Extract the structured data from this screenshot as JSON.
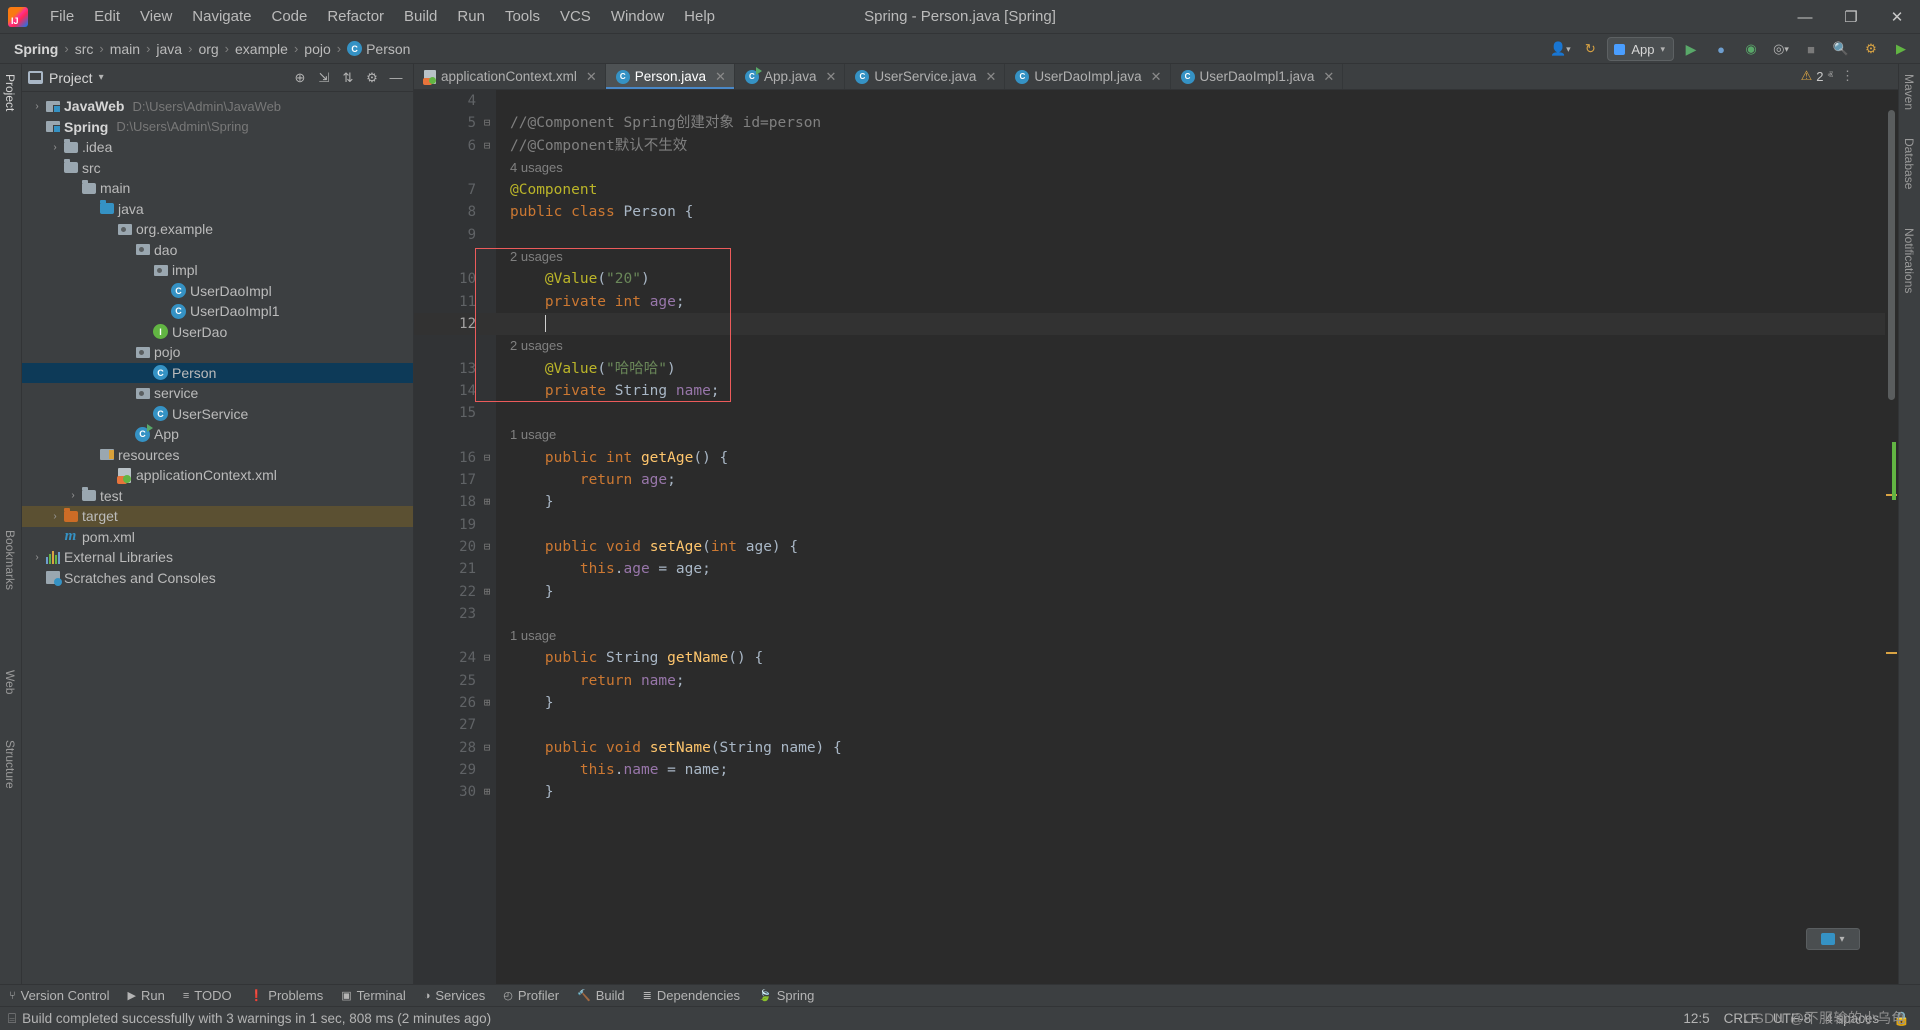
{
  "window": {
    "title": "Spring - Person.java [Spring]",
    "minimize_label": "—",
    "maximize_label": "❐",
    "close_label": "✕"
  },
  "menu": {
    "items": [
      "File",
      "Edit",
      "View",
      "Navigate",
      "Code",
      "Refactor",
      "Build",
      "Run",
      "Tools",
      "VCS",
      "Window",
      "Help"
    ]
  },
  "breadcrumb": {
    "items": [
      "Spring",
      "src",
      "main",
      "java",
      "org",
      "example",
      "pojo",
      "Person"
    ],
    "separator": "›"
  },
  "toolbar": {
    "run_config_label": "App",
    "run_label": "▶",
    "debug_label": "🐞",
    "profile_label": "◉",
    "stop_label": "■",
    "search_label": "🔍",
    "account_label": "👤",
    "update_label": "↻",
    "settings_label": "⚙"
  },
  "left_strip": {
    "items": [
      "Project",
      "Bookmarks",
      "Web",
      "Structure"
    ]
  },
  "right_strip": {
    "items": [
      "Maven",
      "Database",
      "Notifications"
    ]
  },
  "project_panel": {
    "title": "Project",
    "dropdown": "▾",
    "tools": [
      "⊕",
      "⇲",
      "⇅",
      "⚙",
      "—"
    ],
    "tree": [
      {
        "depth": 0,
        "arrow": "›",
        "icon": "module",
        "label": "JavaWeb",
        "bold": true,
        "hint": "D:\\Users\\Admin\\JavaWeb",
        "state": "normal"
      },
      {
        "depth": 0,
        "arrow": "ⱟ",
        "icon": "module",
        "label": "Spring",
        "bold": true,
        "hint": "D:\\Users\\Admin\\Spring",
        "state": "normal"
      },
      {
        "depth": 1,
        "arrow": "›",
        "icon": "folder",
        "label": ".idea",
        "bold": false,
        "hint": "",
        "state": "normal"
      },
      {
        "depth": 1,
        "arrow": "ⱟ",
        "icon": "folder",
        "label": "src",
        "bold": false,
        "hint": "",
        "state": "normal"
      },
      {
        "depth": 2,
        "arrow": "ⱟ",
        "icon": "folder",
        "label": "main",
        "bold": false,
        "hint": "",
        "state": "normal"
      },
      {
        "depth": 3,
        "arrow": "ⱟ",
        "icon": "folder-blue",
        "label": "java",
        "bold": false,
        "hint": "",
        "state": "normal"
      },
      {
        "depth": 4,
        "arrow": "ⱟ",
        "icon": "package",
        "label": "org.example",
        "bold": false,
        "hint": "",
        "state": "normal"
      },
      {
        "depth": 5,
        "arrow": "ⱟ",
        "icon": "package",
        "label": "dao",
        "bold": false,
        "hint": "",
        "state": "normal"
      },
      {
        "depth": 6,
        "arrow": "ⱟ",
        "icon": "package",
        "label": "impl",
        "bold": false,
        "hint": "",
        "state": "normal"
      },
      {
        "depth": 7,
        "arrow": "",
        "icon": "class",
        "label": "UserDaoImpl",
        "bold": false,
        "hint": "",
        "state": "normal"
      },
      {
        "depth": 7,
        "arrow": "",
        "icon": "class",
        "label": "UserDaoImpl1",
        "bold": false,
        "hint": "",
        "state": "normal"
      },
      {
        "depth": 6,
        "arrow": "",
        "icon": "interface",
        "label": "UserDao",
        "bold": false,
        "hint": "",
        "state": "normal"
      },
      {
        "depth": 5,
        "arrow": "ⱟ",
        "icon": "package",
        "label": "pojo",
        "bold": false,
        "hint": "",
        "state": "normal"
      },
      {
        "depth": 6,
        "arrow": "",
        "icon": "class",
        "label": "Person",
        "bold": false,
        "hint": "",
        "state": "selected"
      },
      {
        "depth": 5,
        "arrow": "ⱟ",
        "icon": "package",
        "label": "service",
        "bold": false,
        "hint": "",
        "state": "normal"
      },
      {
        "depth": 6,
        "arrow": "",
        "icon": "class",
        "label": "UserService",
        "bold": false,
        "hint": "",
        "state": "normal"
      },
      {
        "depth": 5,
        "arrow": "",
        "icon": "class-runnable",
        "label": "App",
        "bold": false,
        "hint": "",
        "state": "normal"
      },
      {
        "depth": 3,
        "arrow": "ⱟ",
        "icon": "resources",
        "label": "resources",
        "bold": false,
        "hint": "",
        "state": "normal"
      },
      {
        "depth": 4,
        "arrow": "",
        "icon": "xml",
        "label": "applicationContext.xml",
        "bold": false,
        "hint": "",
        "state": "normal"
      },
      {
        "depth": 2,
        "arrow": "›",
        "icon": "folder",
        "label": "test",
        "bold": false,
        "hint": "",
        "state": "normal"
      },
      {
        "depth": 1,
        "arrow": "›",
        "icon": "folder-orange",
        "label": "target",
        "bold": false,
        "hint": "",
        "state": "highlight"
      },
      {
        "depth": 1,
        "arrow": "",
        "icon": "maven",
        "label": "pom.xml",
        "bold": false,
        "hint": "",
        "state": "normal"
      },
      {
        "depth": 0,
        "arrow": "›",
        "icon": "extlib",
        "label": "External Libraries",
        "bold": false,
        "hint": "",
        "state": "normal"
      },
      {
        "depth": 0,
        "arrow": "",
        "icon": "scratch",
        "label": "Scratches and Consoles",
        "bold": false,
        "hint": "",
        "state": "normal"
      }
    ]
  },
  "editor": {
    "tabs": [
      {
        "label": "applicationContext.xml",
        "icon": "xml",
        "active": false
      },
      {
        "label": "Person.java",
        "icon": "class",
        "active": true
      },
      {
        "label": "App.java",
        "icon": "class-runnable",
        "active": false
      },
      {
        "label": "UserService.java",
        "icon": "class",
        "active": false
      },
      {
        "label": "UserDaoImpl.java",
        "icon": "class",
        "active": false
      },
      {
        "label": "UserDaoImpl1.java",
        "icon": "class",
        "active": false
      }
    ],
    "tab_close": "✕",
    "tab_menu": "⋮",
    "inspection": {
      "warning_count": "2",
      "warning_glyph": "⚠",
      "up": "ⱏ",
      "down": "ⱟ"
    },
    "lines": [
      {
        "num": "4",
        "fold": "",
        "current": false,
        "tokens": []
      },
      {
        "num": "5",
        "fold": "⊟",
        "current": false,
        "tokens": [
          {
            "c": "c-comment",
            "t": "//@Component Spring创建对象 id=person"
          }
        ]
      },
      {
        "num": "6",
        "fold": "⊟",
        "current": false,
        "tokens": [
          {
            "c": "c-comment",
            "t": "//@Component默认不生效"
          }
        ]
      },
      {
        "hint": "4 usages"
      },
      {
        "num": "7",
        "fold": "",
        "current": false,
        "tokens": [
          {
            "c": "c-anno",
            "t": "@Component"
          }
        ]
      },
      {
        "num": "8",
        "fold": "",
        "current": false,
        "tokens": [
          {
            "c": "c-kw",
            "t": "public "
          },
          {
            "c": "c-kw",
            "t": "class "
          },
          {
            "c": "c-class",
            "t": "Person "
          },
          {
            "c": "c-plain",
            "t": "{"
          }
        ]
      },
      {
        "num": "9",
        "fold": "",
        "current": false,
        "tokens": []
      },
      {
        "hint": "2 usages"
      },
      {
        "num": "10",
        "fold": "",
        "current": false,
        "tokens": [
          {
            "c": "c-anno",
            "t": "    @Value"
          },
          {
            "c": "c-paren",
            "t": "("
          },
          {
            "c": "c-str",
            "t": "\"20\""
          },
          {
            "c": "c-paren",
            "t": ")"
          }
        ]
      },
      {
        "num": "11",
        "fold": "",
        "current": false,
        "tokens": [
          {
            "c": "c-kw",
            "t": "    private "
          },
          {
            "c": "c-kw",
            "t": "int "
          },
          {
            "c": "c-field",
            "t": "age"
          },
          {
            "c": "c-plain",
            "t": ";"
          }
        ]
      },
      {
        "num": "12",
        "fold": "",
        "current": true,
        "caret": true,
        "tokens": [
          {
            "c": "c-plain",
            "t": "    "
          }
        ]
      },
      {
        "hint": "2 usages"
      },
      {
        "num": "13",
        "fold": "",
        "current": false,
        "tokens": [
          {
            "c": "c-anno",
            "t": "    @Value"
          },
          {
            "c": "c-paren",
            "t": "("
          },
          {
            "c": "c-str",
            "t": "\"哈哈哈\""
          },
          {
            "c": "c-paren",
            "t": ")"
          }
        ]
      },
      {
        "num": "14",
        "fold": "",
        "current": false,
        "tokens": [
          {
            "c": "c-kw",
            "t": "    private "
          },
          {
            "c": "c-class",
            "t": "String "
          },
          {
            "c": "c-field",
            "t": "name"
          },
          {
            "c": "c-plain",
            "t": ";"
          }
        ]
      },
      {
        "num": "15",
        "fold": "",
        "current": false,
        "tokens": []
      },
      {
        "hint": "1 usage"
      },
      {
        "num": "16",
        "fold": "⊟",
        "current": false,
        "tokens": [
          {
            "c": "c-kw",
            "t": "    public "
          },
          {
            "c": "c-kw",
            "t": "int "
          },
          {
            "c": "c-method",
            "t": "getAge"
          },
          {
            "c": "c-plain",
            "t": "() {"
          }
        ]
      },
      {
        "num": "17",
        "fold": "",
        "current": false,
        "tokens": [
          {
            "c": "c-kw",
            "t": "        return "
          },
          {
            "c": "c-field",
            "t": "age"
          },
          {
            "c": "c-plain",
            "t": ";"
          }
        ]
      },
      {
        "num": "18",
        "fold": "⊞",
        "current": false,
        "tokens": [
          {
            "c": "c-plain",
            "t": "    }"
          }
        ]
      },
      {
        "num": "19",
        "fold": "",
        "current": false,
        "tokens": []
      },
      {
        "num": "20",
        "fold": "⊟",
        "current": false,
        "tokens": [
          {
            "c": "c-kw",
            "t": "    public "
          },
          {
            "c": "c-kw",
            "t": "void "
          },
          {
            "c": "c-method",
            "t": "setAge"
          },
          {
            "c": "c-plain",
            "t": "("
          },
          {
            "c": "c-kw",
            "t": "int "
          },
          {
            "c": "c-plain",
            "t": "age) {"
          }
        ]
      },
      {
        "num": "21",
        "fold": "",
        "current": false,
        "tokens": [
          {
            "c": "c-kw",
            "t": "        this"
          },
          {
            "c": "c-plain",
            "t": "."
          },
          {
            "c": "c-field",
            "t": "age "
          },
          {
            "c": "c-plain",
            "t": "= age;"
          }
        ]
      },
      {
        "num": "22",
        "fold": "⊞",
        "current": false,
        "tokens": [
          {
            "c": "c-plain",
            "t": "    }"
          }
        ]
      },
      {
        "num": "23",
        "fold": "",
        "current": false,
        "tokens": []
      },
      {
        "hint": "1 usage"
      },
      {
        "num": "24",
        "fold": "⊟",
        "current": false,
        "tokens": [
          {
            "c": "c-kw",
            "t": "    public "
          },
          {
            "c": "c-class",
            "t": "String "
          },
          {
            "c": "c-method",
            "t": "getName"
          },
          {
            "c": "c-plain",
            "t": "() {"
          }
        ]
      },
      {
        "num": "25",
        "fold": "",
        "current": false,
        "tokens": [
          {
            "c": "c-kw",
            "t": "        return "
          },
          {
            "c": "c-field",
            "t": "name"
          },
          {
            "c": "c-plain",
            "t": ";"
          }
        ]
      },
      {
        "num": "26",
        "fold": "⊞",
        "current": false,
        "tokens": [
          {
            "c": "c-plain",
            "t": "    }"
          }
        ]
      },
      {
        "num": "27",
        "fold": "",
        "current": false,
        "tokens": []
      },
      {
        "num": "28",
        "fold": "⊟",
        "current": false,
        "tokens": [
          {
            "c": "c-kw",
            "t": "    public "
          },
          {
            "c": "c-kw",
            "t": "void "
          },
          {
            "c": "c-method",
            "t": "setName"
          },
          {
            "c": "c-plain",
            "t": "("
          },
          {
            "c": "c-class",
            "t": "String "
          },
          {
            "c": "c-plain",
            "t": "name) {"
          }
        ]
      },
      {
        "num": "29",
        "fold": "",
        "current": false,
        "tokens": [
          {
            "c": "c-kw",
            "t": "        this"
          },
          {
            "c": "c-plain",
            "t": "."
          },
          {
            "c": "c-field",
            "t": "name "
          },
          {
            "c": "c-plain",
            "t": "= name;"
          }
        ]
      },
      {
        "num": "30",
        "fold": "⊞",
        "current": false,
        "tokens": [
          {
            "c": "c-plain",
            "t": "    }"
          }
        ]
      }
    ]
  },
  "bottom_tools": {
    "items": [
      {
        "label": "Version Control",
        "icon": "⑂"
      },
      {
        "label": "Run",
        "icon": "▶"
      },
      {
        "label": "TODO",
        "icon": "≡"
      },
      {
        "label": "Problems",
        "icon": "❗"
      },
      {
        "label": "Terminal",
        "icon": "▣"
      },
      {
        "label": "Services",
        "icon": "◑"
      },
      {
        "label": "Profiler",
        "icon": "◴"
      },
      {
        "label": "Build",
        "icon": "🔨"
      },
      {
        "label": "Dependencies",
        "icon": "≣"
      },
      {
        "label": "Spring",
        "icon": "🍃"
      }
    ]
  },
  "statusbar": {
    "message": "Build completed successfully with 3 warnings in 1 sec, 808 ms (2 minutes ago)",
    "message_icon": "⌸",
    "caret_position": "12:5",
    "line_separator": "CRLF",
    "encoding": "UTF-8",
    "indent": "4 spaces",
    "lock": "🔒",
    "watermark": "CSDN @不服输的小乌龟"
  },
  "colors": {
    "accent": "#4a88c7",
    "selection": "#0d3a58",
    "warning": "#d9a343",
    "red_highlight": "#ec5b5b",
    "editor_bg": "#2b2b2b",
    "panel_bg": "#3c3f41"
  }
}
